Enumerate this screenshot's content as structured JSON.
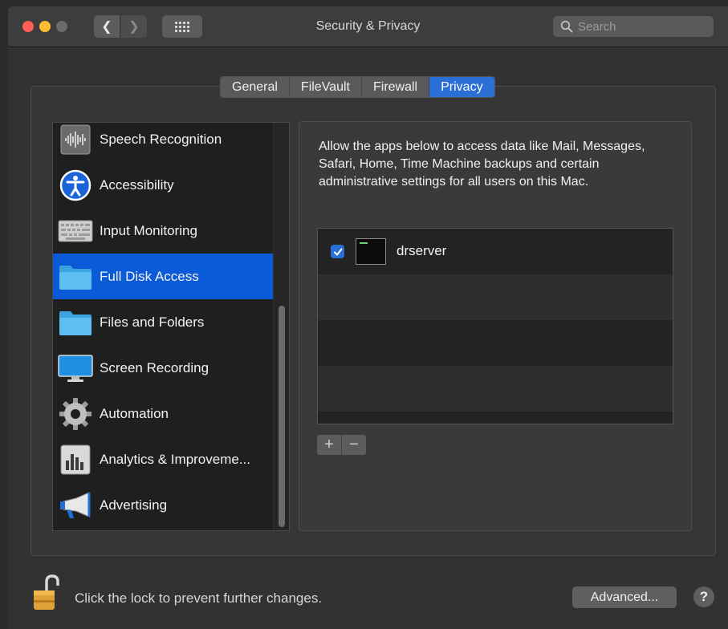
{
  "window": {
    "title": "Security & Privacy"
  },
  "toolbar": {
    "search_placeholder": "Search"
  },
  "tabs": [
    {
      "label": "General",
      "active": false
    },
    {
      "label": "FileVault",
      "active": false
    },
    {
      "label": "Firewall",
      "active": false
    },
    {
      "label": "Privacy",
      "active": true
    }
  ],
  "sidebar": {
    "items": [
      {
        "label": "Speech Recognition",
        "icon": "waveform-icon",
        "selected": false
      },
      {
        "label": "Accessibility",
        "icon": "accessibility-icon",
        "selected": false
      },
      {
        "label": "Input Monitoring",
        "icon": "keyboard-icon",
        "selected": false
      },
      {
        "label": "Full Disk Access",
        "icon": "folder-icon",
        "selected": true
      },
      {
        "label": "Files and Folders",
        "icon": "folder-icon",
        "selected": false
      },
      {
        "label": "Screen Recording",
        "icon": "display-icon",
        "selected": false
      },
      {
        "label": "Automation",
        "icon": "gear-icon",
        "selected": false
      },
      {
        "label": "Analytics & Improveme...",
        "icon": "bar-chart-icon",
        "selected": false
      },
      {
        "label": "Advertising",
        "icon": "megaphone-icon",
        "selected": false
      }
    ]
  },
  "panel": {
    "description": "Allow the apps below to access data like Mail, Messages, Safari, Home, Time Machine backups and certain administrative settings for all users on this Mac.",
    "apps": [
      {
        "name": "drserver",
        "checked": true,
        "icon": "terminal-icon"
      }
    ],
    "add_label": "+",
    "remove_label": "−"
  },
  "footer": {
    "lock_message": "Click the lock to prevent further changes.",
    "advanced_label": "Advanced...",
    "help_label": "?"
  },
  "colors": {
    "accent": "#2a6fd6",
    "selection": "#0b5ad8",
    "traffic_red": "#ff5f57",
    "traffic_yellow": "#febc2e"
  }
}
